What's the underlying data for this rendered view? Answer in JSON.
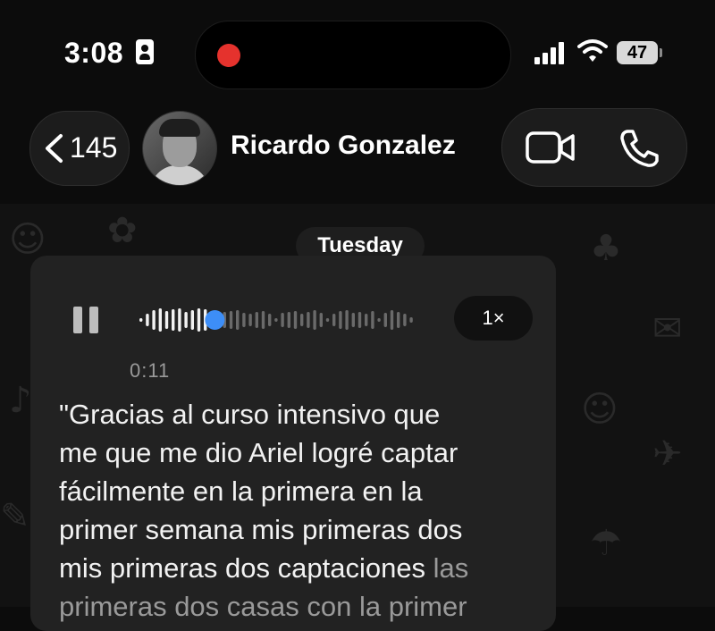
{
  "status_bar": {
    "time": "3:08",
    "battery": "47",
    "icons": [
      "contact-card-icon",
      "record-indicator-icon",
      "cellular-signal-icon",
      "wifi-icon",
      "battery-icon"
    ]
  },
  "header": {
    "back_count": "145",
    "contact_name": "Ricardo Gonzalez",
    "icons": [
      "chevron-left-icon",
      "video-call-icon",
      "phone-call-icon"
    ]
  },
  "chat": {
    "date_label": "Tuesday",
    "voice_message": {
      "elapsed": "0:11",
      "playback_speed": "1×",
      "progress": 0.27,
      "transcript_bright": "\"Gracias al curso intensivo que\nme que me dio Ariel logré captar\nfácilmente en la primera en la\nprimer semana mis primeras dos\nmis primeras dos captaciones ",
      "transcript_dim": "las\nprimeras dos casas con la primer"
    }
  },
  "colors": {
    "background": "#0c0c0c",
    "bubble": "#222222",
    "accent_blue": "#3d8ef7",
    "record_red": "#e5322d"
  }
}
